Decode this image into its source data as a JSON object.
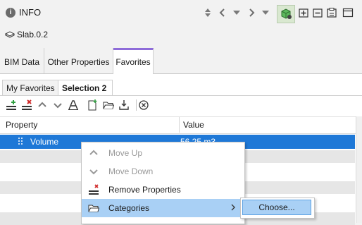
{
  "header": {
    "title": "INFO",
    "info_icon_glyph": "i",
    "buttons": [
      "up-down-icon",
      "chevron-left-icon",
      "triangle-down-icon",
      "chevron-right-icon",
      "triangle-down-icon",
      "settings-cube-icon",
      "add-panel-icon",
      "remove-panel-icon",
      "clipboard-panel-icon",
      "window-icon"
    ]
  },
  "element": {
    "name": "Slab.0.2",
    "icon": "slab-icon"
  },
  "main_tabs": [
    {
      "label": "BIM Data",
      "active": false
    },
    {
      "label": "Other Properties",
      "active": false
    },
    {
      "label": "Favorites",
      "active": true
    }
  ],
  "sub_tabs": [
    {
      "label": "My Favorites",
      "active": false
    },
    {
      "label": "Selection 2",
      "active": true
    }
  ],
  "toolbar": {
    "icons": [
      "add-row-icon",
      "remove-row-icon",
      "move-up-icon",
      "move-down-icon",
      "text-format-icon",
      "new-file-icon",
      "open-folder-icon",
      "import-icon",
      "cancel-icon"
    ]
  },
  "table": {
    "columns": [
      "Property",
      "Value"
    ],
    "rows": [
      {
        "property": "Volume",
        "value": "56.25 m3",
        "selected": true
      }
    ]
  },
  "context_menu": {
    "items": [
      {
        "label": "Move Up",
        "enabled": false,
        "icon": "chevron-up-icon"
      },
      {
        "label": "Move Down",
        "enabled": false,
        "icon": "chevron-down-icon"
      },
      {
        "label": "Remove Properties",
        "enabled": true,
        "icon": "remove-properties-icon"
      },
      {
        "label": "Categories",
        "enabled": true,
        "icon": "folder-icon",
        "has_submenu": true
      }
    ],
    "submenu": {
      "items": [
        {
          "label": "Choose..."
        }
      ]
    }
  },
  "colors": {
    "accent": "#8e6cd9",
    "selection": "#1e78d7",
    "menu_highlight": "#a9d0f5",
    "add_green": "#2e9e3e",
    "remove_red": "#d02a2a"
  }
}
